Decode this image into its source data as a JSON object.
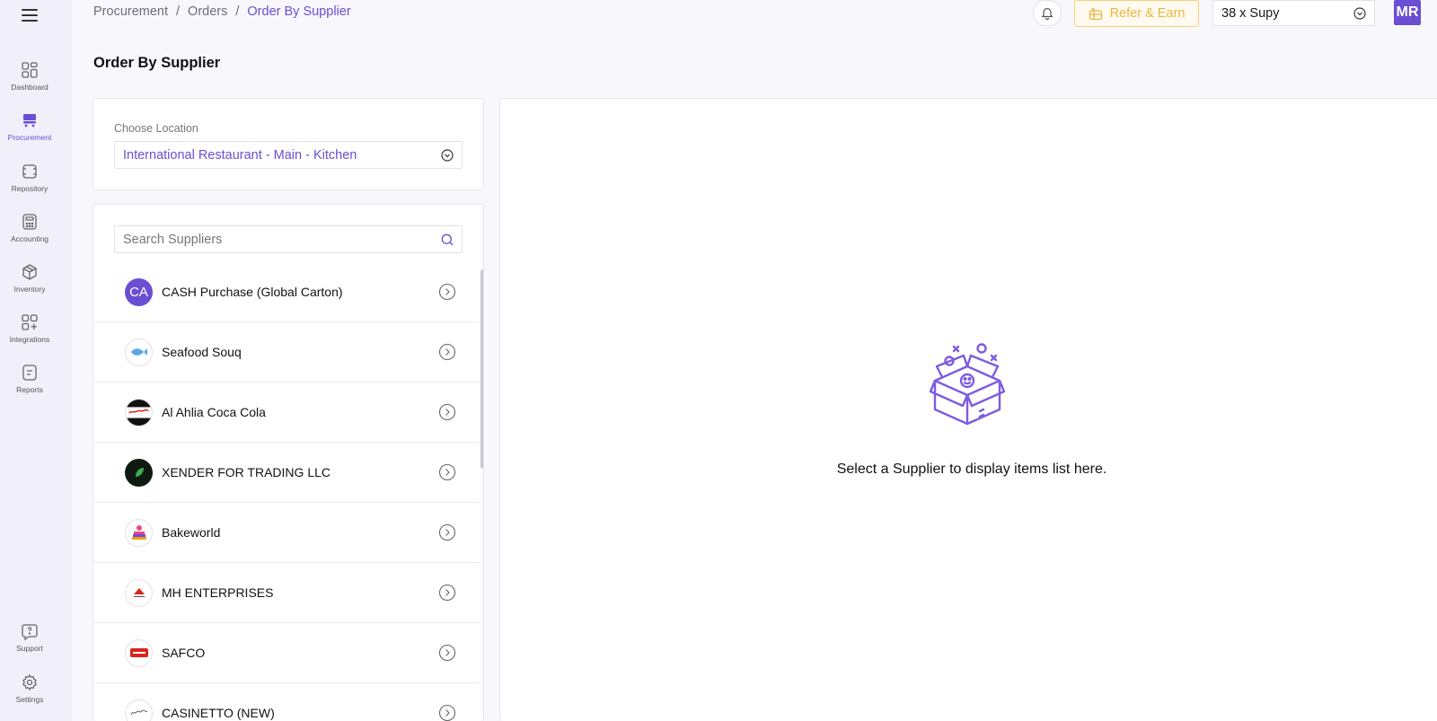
{
  "breadcrumb": [
    "Procurement",
    "Orders",
    "Order By Supplier"
  ],
  "header": {
    "refer_label": "Refer & Earn",
    "outlet_value": "38 x Supy",
    "avatar_initials": "MR"
  },
  "sidebar": {
    "items": [
      {
        "label": "Dashboard",
        "icon": "dashboard-icon"
      },
      {
        "label": "Procurement",
        "icon": "cart-icon",
        "active": true
      },
      {
        "label": "Repository",
        "icon": "repository-icon"
      },
      {
        "label": "Accounting",
        "icon": "calculator-icon"
      },
      {
        "label": "Inventory",
        "icon": "box-icon"
      },
      {
        "label": "Integrations",
        "icon": "integrations-icon"
      },
      {
        "label": "Reports",
        "icon": "reports-icon"
      }
    ],
    "bottom": [
      {
        "label": "Support",
        "icon": "help-icon"
      },
      {
        "label": "Settings",
        "icon": "gear-icon"
      }
    ]
  },
  "page": {
    "title": "Order By Supplier"
  },
  "location": {
    "label": "Choose Location",
    "value": "International Restaurant - Main - Kitchen"
  },
  "search": {
    "placeholder": "Search Suppliers"
  },
  "suppliers": [
    {
      "name": "CASH Purchase (Global Carton)",
      "logo": "CA"
    },
    {
      "name": "Seafood Souq",
      "logo": ""
    },
    {
      "name": "Al Ahlia Coca Cola",
      "logo": ""
    },
    {
      "name": "XENDER FOR TRADING LLC",
      "logo": ""
    },
    {
      "name": "Bakeworld",
      "logo": ""
    },
    {
      "name": "MH ENTERPRISES",
      "logo": ""
    },
    {
      "name": "SAFCO",
      "logo": ""
    },
    {
      "name": "CASINETTO (NEW)",
      "logo": ""
    }
  ],
  "empty_state": {
    "message": "Select a Supplier to display items list here."
  },
  "colors": {
    "accent": "#6b4ed3",
    "refer": "#e9b740"
  }
}
